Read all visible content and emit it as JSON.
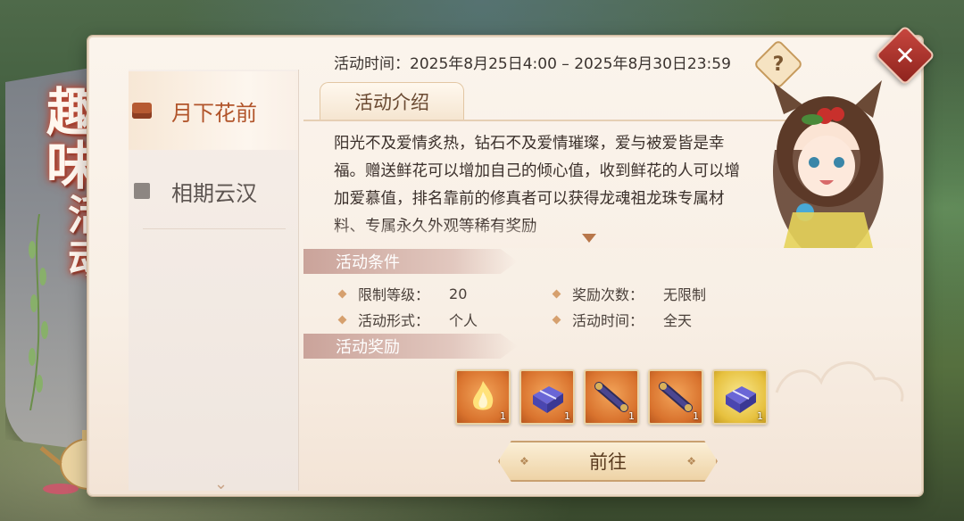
{
  "banner": {
    "title_line1": "趣",
    "title_line2": "味",
    "title_line3": "活",
    "title_line4": "动"
  },
  "sidebar": {
    "items": [
      {
        "label": "月下花前",
        "icon": "chest-icon",
        "active": true
      },
      {
        "label": "相期云汉",
        "icon": "calendar-icon",
        "active": false
      }
    ]
  },
  "header": {
    "time_label": "活动时间：2025年8月25日4:00 – 2025年8月30日23:59",
    "help": "?"
  },
  "intro": {
    "tab_label": "活动介绍",
    "text": "阳光不及爱情炙热，钻石不及爱情璀璨，爱与被爱皆是幸福。赠送鲜花可以增加自己的倾心值，收到鲜花的人可以增加爱慕值，排名靠前的修真者可以获得龙魂祖龙珠专属材料、专属永久外观等稀有奖励"
  },
  "conditions": {
    "title": "活动条件",
    "level_label": "限制等级：",
    "level_value": "20",
    "reward_count_label": "奖励次数：",
    "reward_count_value": "无限制",
    "form_label": "活动形式：",
    "form_value": "个人",
    "time_label": "活动时间：",
    "time_value": "全天"
  },
  "rewards": {
    "title": "活动奖励",
    "items": [
      {
        "icon": "flame-icon",
        "count": "1",
        "bg": "orange"
      },
      {
        "icon": "gift-box-icon",
        "count": "1",
        "bg": "orange"
      },
      {
        "icon": "scroll-icon",
        "count": "1",
        "bg": "orange"
      },
      {
        "icon": "scroll-icon",
        "count": "1",
        "bg": "orange"
      },
      {
        "icon": "gift-box-icon",
        "count": "1",
        "bg": "yellow"
      }
    ]
  },
  "actions": {
    "go_label": "前往"
  },
  "colors": {
    "accent": "#b1542a",
    "section_header": "#caa39a",
    "close": "#c8473f"
  }
}
